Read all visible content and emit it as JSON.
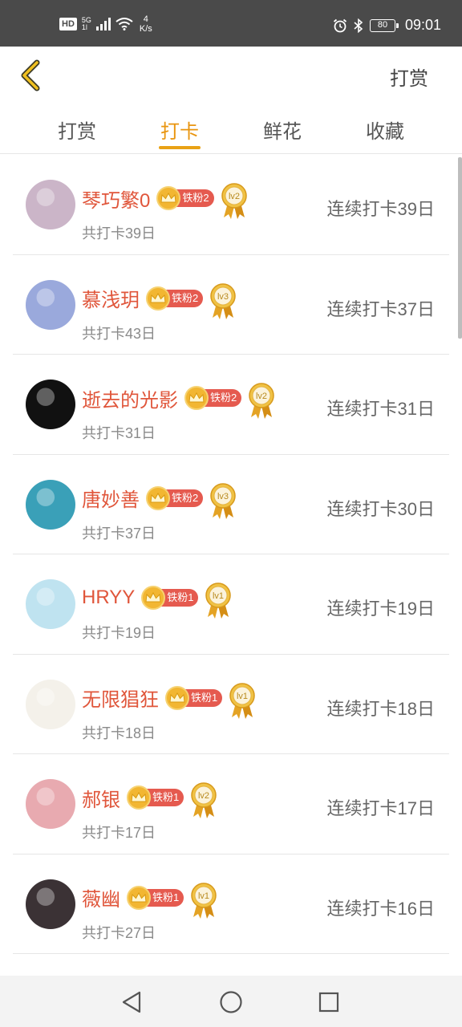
{
  "status_bar": {
    "hd": "HD",
    "net_top": "5G",
    "net_bottom": "1l",
    "speed_value": "4",
    "speed_unit": "K/s",
    "battery": "80",
    "time": "09:01"
  },
  "header": {
    "right_action": "打赏"
  },
  "tabs": [
    {
      "label": "打赏",
      "active": false
    },
    {
      "label": "打卡",
      "active": true
    },
    {
      "label": "鲜花",
      "active": false
    },
    {
      "label": "收藏",
      "active": false
    }
  ],
  "colors": {
    "accent": "#e9950f",
    "name": "#e0563b",
    "badge": "#e55a4f"
  },
  "rows": [
    {
      "name": "琴巧繁0",
      "fan": "铁粉2",
      "level": "lv2",
      "total": "共打卡39日",
      "streak": "连续打卡39日",
      "avatar_color": "#cbb5c8"
    },
    {
      "name": "慕浅玥",
      "fan": "铁粉2",
      "level": "lv3",
      "total": "共打卡43日",
      "streak": "连续打卡37日",
      "avatar_color": "#9aa9dc"
    },
    {
      "name": "逝去的光影",
      "fan": "铁粉2",
      "level": "lv2",
      "total": "共打卡31日",
      "streak": "连续打卡31日",
      "avatar_color": "#111111"
    },
    {
      "name": "唐妙善",
      "fan": "铁粉2",
      "level": "lv3",
      "total": "共打卡37日",
      "streak": "连续打卡30日",
      "avatar_color": "#3aa0b8"
    },
    {
      "name": "HRYY",
      "fan": "铁粉1",
      "level": "lv1",
      "total": "共打卡19日",
      "streak": "连续打卡19日",
      "avatar_color": "#bfe3f0"
    },
    {
      "name": "无限猖狂",
      "fan": "铁粉1",
      "level": "lv1",
      "total": "共打卡18日",
      "streak": "连续打卡18日",
      "avatar_color": "#f4f1ea"
    },
    {
      "name": "郝银",
      "fan": "铁粉1",
      "level": "lv2",
      "total": "共打卡17日",
      "streak": "连续打卡17日",
      "avatar_color": "#e8aab0"
    },
    {
      "name": "薇幽",
      "fan": "铁粉1",
      "level": "lv1",
      "total": "共打卡27日",
      "streak": "连续打卡16日",
      "avatar_color": "#3b3235"
    }
  ],
  "icons": {
    "back": "chevron-left-icon",
    "crown": "crown-icon",
    "medal": "medal-icon",
    "nav_back": "triangle-back-icon",
    "nav_home": "circle-home-icon",
    "nav_recent": "square-recent-icon"
  }
}
